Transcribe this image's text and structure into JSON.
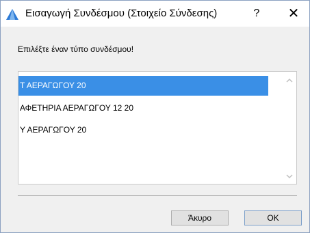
{
  "window": {
    "title": "Εισαγωγή Συνδέσμου (Στοιχείο Σύνδεσης)",
    "help_label": "?",
    "close_label": "✕"
  },
  "prompt": "Επιλέξτε έναν τύπο συνδέσμου!",
  "list": {
    "items": [
      {
        "label": "Τ ΑΕΡΑΓΩΓΟΥ 20",
        "selected": true
      },
      {
        "label": "ΑΦΕΤΗΡΙΑ ΑΕΡΑΓΩΓΟΥ 12 20",
        "selected": false
      },
      {
        "label": "Υ ΑΕΡΑΓΩΓΟΥ 20",
        "selected": false
      }
    ],
    "selection_color": "#3a8fe6"
  },
  "buttons": {
    "cancel_label": "Άκυρο",
    "ok_label": "OK"
  },
  "icons": {
    "app": "archicad-triangle-icon",
    "scroll_up": "chevron-up-icon",
    "scroll_down": "chevron-down-icon"
  }
}
